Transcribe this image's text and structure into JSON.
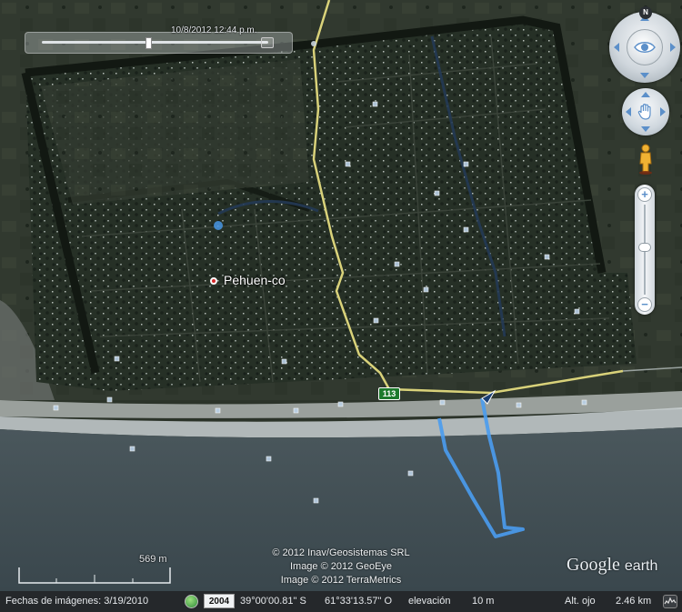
{
  "timeslider": {
    "date_time": "10/8/2012  12:44 p.m."
  },
  "map": {
    "place_name": "Pehuen-co",
    "route_number": "113"
  },
  "scale": {
    "label": "569 m"
  },
  "copyright": {
    "lines": [
      "© 2012 Inav/Geosistemas SRL",
      "Image © 2012 GeoEye",
      "Image © 2012 TerraMetrics"
    ]
  },
  "logo": {
    "google": "Google",
    "earth": "earth"
  },
  "navigation": {
    "north": "N"
  },
  "status": {
    "imagery_dates_label": "Fechas de imágenes: 3/19/2010",
    "year": "2004",
    "latitude": "39°00'00.81\" S",
    "longitude": "61°33'13.57\" O",
    "elevation_label": "elevación",
    "elevation_value": "10 m",
    "eye_alt_label": "Alt. ojo",
    "eye_alt_value": "2.46 km"
  },
  "colors": {
    "road": "#d9d27a",
    "track": "#4a9cf0",
    "ocean": "#3c4a50",
    "land": "#2a3228"
  }
}
